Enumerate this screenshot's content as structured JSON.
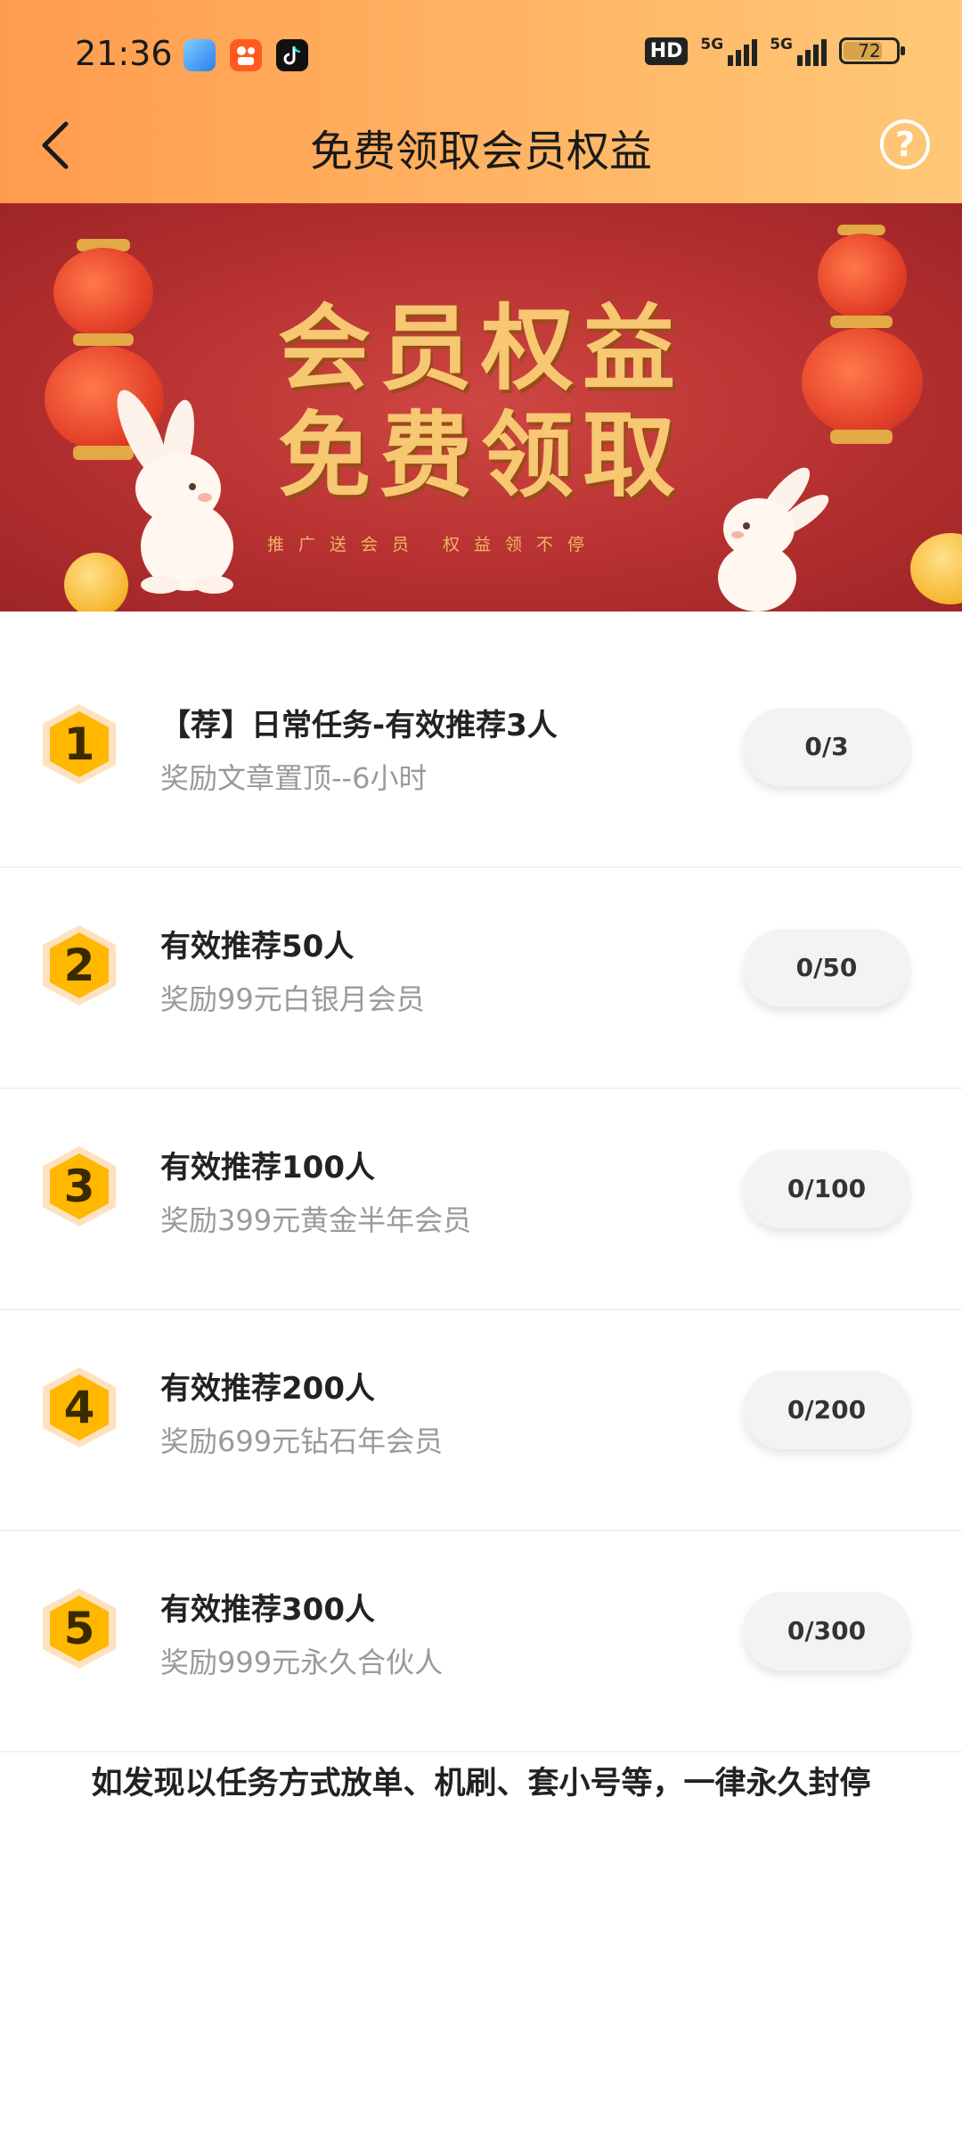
{
  "status_bar": {
    "time": "21:36",
    "hd_label": "HD",
    "signal1_label": "5G",
    "signal2_label": "5G",
    "battery": "72",
    "app_icons": [
      "browser-icon",
      "kuaishou-icon",
      "tiktok-icon"
    ]
  },
  "header": {
    "title": "免费领取会员权益",
    "back_icon": "back-arrow-icon",
    "help_icon": "help-icon",
    "help_glyph": "?"
  },
  "banner": {
    "line1": "会员权益",
    "line2": "免费领取",
    "sub": "推广送会员  权益领不停"
  },
  "tasks": [
    {
      "num": "1",
      "title": "【荐】日常任务-有效推荐3人",
      "desc": "奖励文章置顶--6小时",
      "progress": "0/3"
    },
    {
      "num": "2",
      "title": "有效推荐50人",
      "desc": "奖励99元白银月会员",
      "progress": "0/50"
    },
    {
      "num": "3",
      "title": "有效推荐100人",
      "desc": "奖励399元黄金半年会员",
      "progress": "0/100"
    },
    {
      "num": "4",
      "title": "有效推荐200人",
      "desc": "奖励699元钻石年会员",
      "progress": "0/200"
    },
    {
      "num": "5",
      "title": "有效推荐300人",
      "desc": "奖励999元永久合伙人",
      "progress": "0/300"
    }
  ],
  "notice": "如发现以任务方式放单、机刷、套小号等，一律永久封停",
  "colors": {
    "header_gradient_start": "#ff9b4e",
    "header_gradient_end": "#ffc878",
    "banner_red": "#b42f2f",
    "banner_gold": "#f7c772",
    "badge_yellow": "#ffb700"
  }
}
